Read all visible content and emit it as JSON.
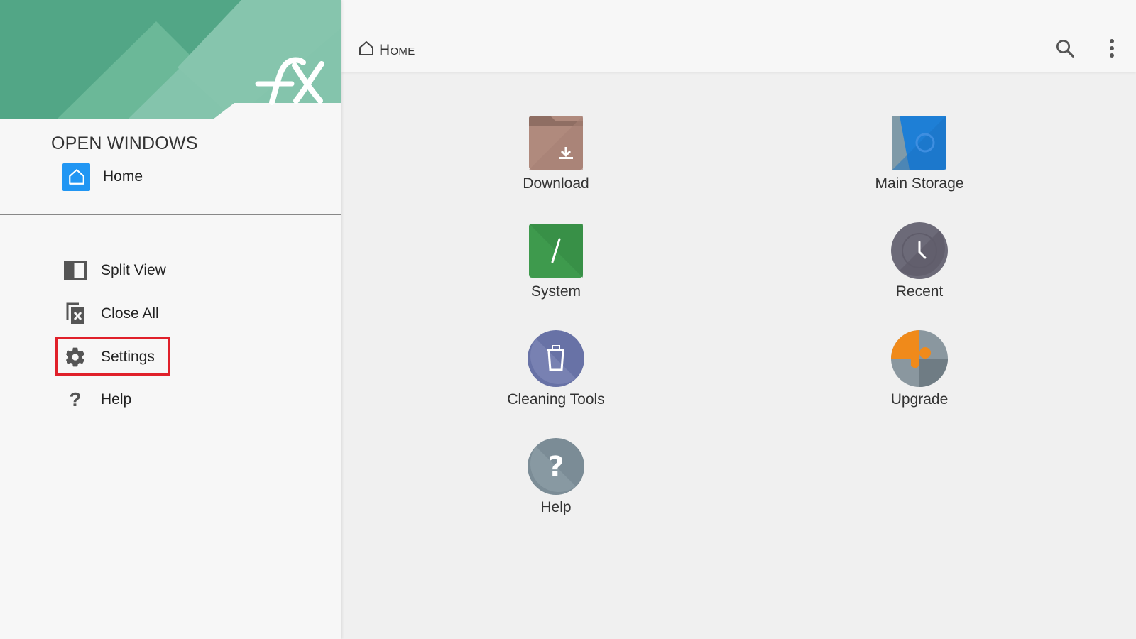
{
  "drawer": {
    "open_windows_title": "OPEN WINDOWS",
    "windows": [
      {
        "label": "Home",
        "icon": "home-icon"
      }
    ],
    "menu": [
      {
        "label": "Split View",
        "icon": "split-view-icon"
      },
      {
        "label": "Close All",
        "icon": "close-all-icon"
      },
      {
        "label": "Settings",
        "icon": "gear-icon",
        "highlighted": true
      },
      {
        "label": "Help",
        "icon": "question-icon"
      }
    ],
    "brand_logo_text": "FX"
  },
  "toolbar": {
    "breadcrumb": "Home",
    "search_icon": "search-icon",
    "overflow_icon": "more-vertical-icon"
  },
  "tiles": [
    {
      "label": "Download",
      "icon": "download-folder-icon"
    },
    {
      "label": "Main Storage",
      "icon": "storage-icon"
    },
    {
      "label": "System",
      "icon": "system-root-icon"
    },
    {
      "label": "Recent",
      "icon": "clock-icon"
    },
    {
      "label": "Cleaning Tools",
      "icon": "trash-icon"
    },
    {
      "label": "Upgrade",
      "icon": "puzzle-icon"
    },
    {
      "label": "Help",
      "icon": "help-icon"
    }
  ],
  "colors": {
    "header_green": "#5aaa8a",
    "accent_blue": "#2196f3",
    "highlight_red": "#e0202a"
  }
}
